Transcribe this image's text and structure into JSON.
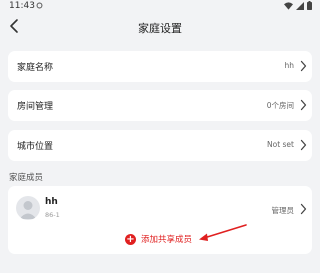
{
  "status_bar": {
    "time": "11:43"
  },
  "header": {
    "title": "家庭设置"
  },
  "rows": [
    {
      "label": "家庭名称",
      "value": "hh"
    },
    {
      "label": "房间管理",
      "value": "0个房间"
    },
    {
      "label": "城市位置",
      "value": "Not set"
    }
  ],
  "members_section": {
    "label": "家庭成员",
    "members": [
      {
        "name": "hh",
        "phone": "86-1",
        "role": "管理员"
      }
    ],
    "add_label": "添加共享成员"
  },
  "colors": {
    "accent": "#e02020",
    "background": "#f2f3f5",
    "card": "#ffffff"
  },
  "icons": [
    "back-chevron",
    "chevron-right",
    "plus-circle",
    "avatar-person",
    "wifi",
    "battery"
  ]
}
